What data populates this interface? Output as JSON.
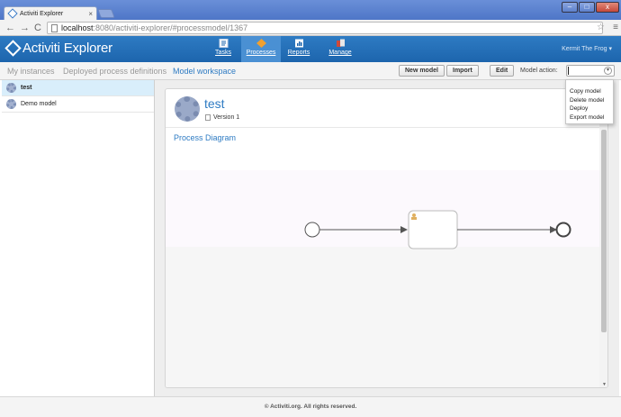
{
  "browser": {
    "tab_title": "Activiti Explorer",
    "tab_close": "×",
    "url_host": "localhost",
    "url_rest": ":8080/activiti-explorer/#processmodel/1367",
    "back": "←",
    "forward": "→",
    "reload": "C",
    "star": "☆",
    "menu": "≡",
    "win_min": "–",
    "win_max": "□",
    "win_close": "x"
  },
  "header": {
    "logo_text": "Activiti Explorer",
    "nav": [
      {
        "label": "Tasks",
        "icon": "tasks-icon"
      },
      {
        "label": "Processes",
        "icon": "processes-icon"
      },
      {
        "label": "Reports",
        "icon": "reports-icon"
      },
      {
        "label": "Manage",
        "icon": "manage-icon"
      }
    ],
    "active_nav": "Processes",
    "user": "Kermit The Frog ▾"
  },
  "subnav": {
    "links": [
      "My instances",
      "Deployed process definitions",
      "Model workspace"
    ],
    "active": "Model workspace",
    "buttons": {
      "new_model": "New model",
      "import": "Import",
      "edit": "Edit"
    },
    "model_action_label": "Model action:",
    "model_action_value": "",
    "arrow": "▾"
  },
  "models": [
    {
      "name": "test",
      "selected": true
    },
    {
      "name": "Demo model",
      "selected": false
    }
  ],
  "detail": {
    "title": "test",
    "version": "Version 1",
    "diagram_link": "Process Diagram"
  },
  "dropdown": {
    "options": [
      "Copy model",
      "Delete model",
      "Deploy",
      "Export model"
    ]
  },
  "footer": {
    "text": "© Activiti.org. All rights reserved."
  },
  "colors": {
    "brand_blue": "#2e7bc3",
    "header_bg": "#1d65ad",
    "selected_row": "#d9eefb"
  }
}
